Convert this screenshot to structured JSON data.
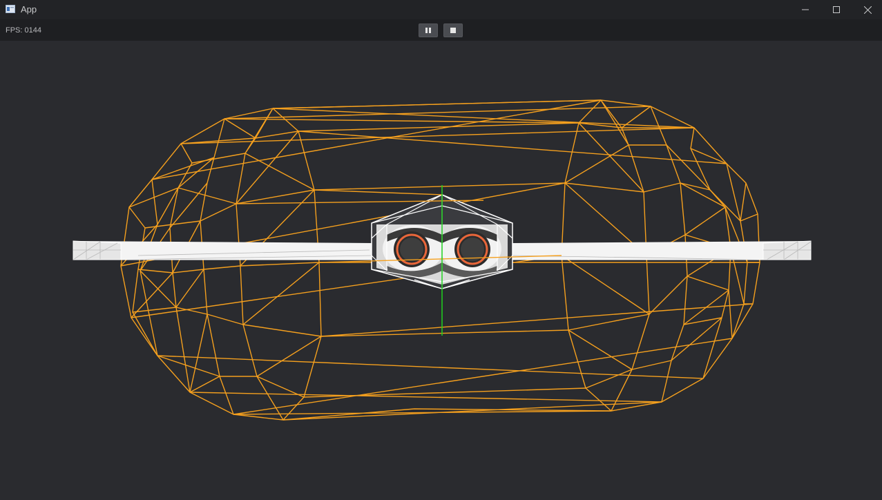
{
  "window": {
    "title": "App"
  },
  "toolbar": {
    "fps_label": "FPS: 0144"
  },
  "colors": {
    "wire_collider": "#f5a01e",
    "mesh_white": "#f2f2f2",
    "axis_green": "#1fd11f",
    "accent_orange": "#e8663a"
  },
  "icons": {
    "app": "app-window-icon",
    "minimize": "minimize-icon",
    "maximize": "maximize-icon",
    "close": "close-icon",
    "pause": "pause-icon",
    "stop": "stop-icon"
  }
}
